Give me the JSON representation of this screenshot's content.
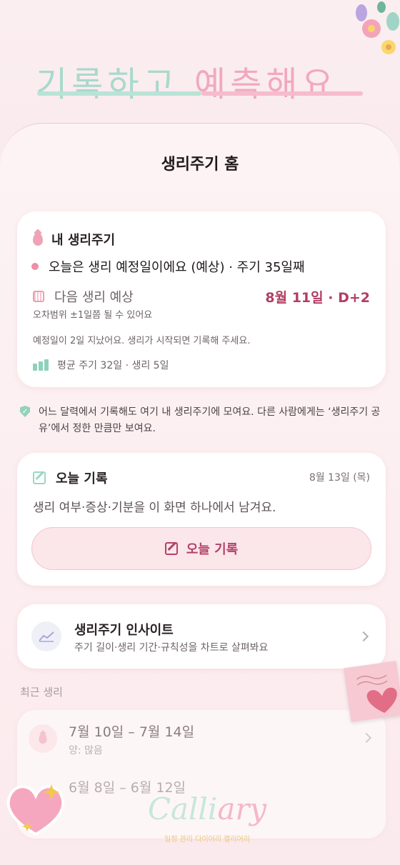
{
  "hero": {
    "title_part1": "기록하고",
    "title_part2": "예측해요."
  },
  "sheet": {
    "title": "생리주기 홈"
  },
  "cycle_card": {
    "title": "내 생리주기",
    "status": "오늘은 생리 예정일이에요 (예상) · 주기 35일째",
    "next_label": "다음 생리 예상",
    "next_value": "8월 11일 · D+2",
    "range_note": "오차범위 ±1일쯤 될 수 있어요",
    "overdue_note": "예정일이 2일 지났어요. 생리가 시작되면 기록해 주세요.",
    "average": "평균 주기 32일 · 생리 5일"
  },
  "privacy_note": "어느 달력에서 기록해도 여기 내 생리주기에 모여요. 다른 사람에게는 ‘생리주기 공유’에서 정한 만큼만 보여요.",
  "today_card": {
    "title": "오늘 기록",
    "date": "8월 13일 (목)",
    "desc": "생리 여부·증상·기분을 이 화면 하나에서 남겨요.",
    "button_label": "오늘 기록"
  },
  "insight_card": {
    "title": "생리주기 인사이트",
    "subtitle": "주기 길이·생리 기간·규칙성을 차트로 살펴봐요"
  },
  "recent": {
    "label": "최근 생리",
    "items": [
      {
        "range": "7월 10일 – 7월 14일",
        "detail": "양: 많음"
      },
      {
        "range": "6월 8일 – 6월 12일",
        "detail": ""
      }
    ]
  },
  "watermark": {
    "text_a": "Calli",
    "text_b": "ary",
    "sub": "일정 관리 다이어리 캘리어리"
  },
  "colors": {
    "accent": "#b23e63",
    "mint": "#9dd6c3",
    "pink": "#f0a3b7"
  }
}
